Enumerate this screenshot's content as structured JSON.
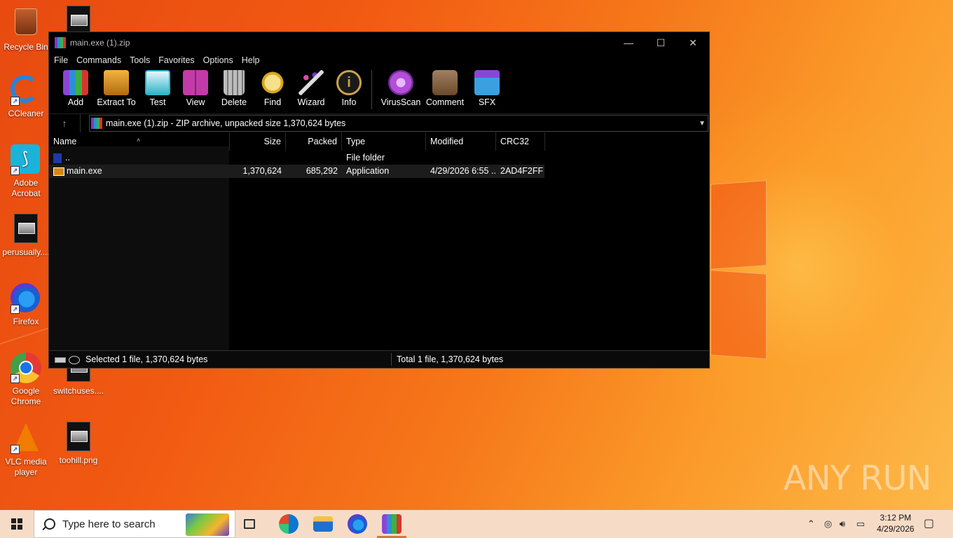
{
  "desktop": {
    "icons": [
      {
        "label": "Recycle Bin",
        "icon": "recycle-bin-icon"
      },
      {
        "label": "CCleaner",
        "icon": "ccleaner-icon"
      },
      {
        "label": "Adobe Acrobat",
        "icon": "acrobat-icon"
      },
      {
        "label": "perusually....",
        "icon": "image-file-icon"
      },
      {
        "label": "Firefox",
        "icon": "firefox-icon"
      },
      {
        "label": "Google Chrome",
        "icon": "chrome-icon"
      },
      {
        "label": "VLC media player",
        "icon": "vlc-icon"
      },
      {
        "label": "switchuses....",
        "icon": "image-file-icon"
      },
      {
        "label": "toohill.png",
        "icon": "image-file-icon"
      }
    ],
    "watermark": "ANY RUN"
  },
  "window": {
    "title": "main.exe (1).zip",
    "controls": {
      "minimize": "—",
      "maximize": "☐",
      "close": "✕"
    },
    "menu": [
      "File",
      "Commands",
      "Tools",
      "Favorites",
      "Options",
      "Help"
    ],
    "toolbar": [
      {
        "label": "Add",
        "icon": "add-archive-icon",
        "color": "#8b45d6"
      },
      {
        "label": "Extract To",
        "icon": "extract-folder-icon",
        "color": "#d9901f"
      },
      {
        "label": "Test",
        "icon": "test-clipboard-icon",
        "color": "#2fb6c8"
      },
      {
        "label": "View",
        "icon": "view-book-icon",
        "color": "#c33aa8"
      },
      {
        "label": "Delete",
        "icon": "delete-trash-icon",
        "color": "#9a9a9a"
      },
      {
        "label": "Find",
        "icon": "find-magnifier-icon",
        "color": "#d8a520"
      },
      {
        "label": "Wizard",
        "icon": "wizard-wand-icon",
        "color": "#6d3ad0"
      },
      {
        "label": "Info",
        "icon": "info-icon",
        "color": "#caa24a"
      },
      {
        "label": "VirusScan",
        "icon": "virusscan-icon",
        "color": "#b24fd6"
      },
      {
        "label": "Comment",
        "icon": "comment-icon",
        "color": "#8a6a4a"
      },
      {
        "label": "SFX",
        "icon": "sfx-archive-icon",
        "color": "#3aa0e0"
      }
    ],
    "address": "main.exe (1).zip - ZIP archive, unpacked size 1,370,624 bytes",
    "columns": [
      "Name",
      "Size",
      "Packed",
      "Type",
      "Modified",
      "CRC32"
    ],
    "rows": [
      {
        "name": "..",
        "size": "",
        "packed": "",
        "type": "File folder",
        "modified": "",
        "crc": ""
      },
      {
        "name": "main.exe",
        "size": "1,370,624",
        "packed": "685,292",
        "type": "Application",
        "modified": "4/29/2026 6:55 ...",
        "crc": "2AD4F2FF"
      }
    ],
    "status_left": "Selected 1 file, 1,370,624 bytes",
    "status_right": "Total 1 file, 1,370,624 bytes"
  },
  "taskbar": {
    "search_placeholder": "Type here to search",
    "time": "3:12 PM",
    "date": "4/29/2026"
  }
}
